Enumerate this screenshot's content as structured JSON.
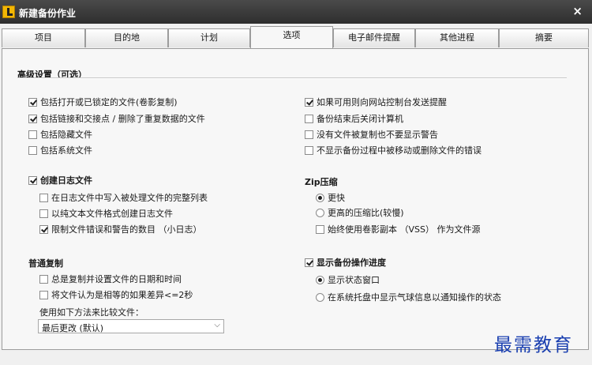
{
  "window": {
    "title": "新建备份作业",
    "close_glyph": "×"
  },
  "tabs": [
    {
      "label": "项目",
      "active": false
    },
    {
      "label": "目的地",
      "active": false
    },
    {
      "label": "计划",
      "active": false
    },
    {
      "label": "选项",
      "active": true
    },
    {
      "label": "电子邮件提醒",
      "active": false
    },
    {
      "label": "其他进程",
      "active": false
    },
    {
      "label": "摘要",
      "active": false
    }
  ],
  "advanced": {
    "title": "高级设置（可选）",
    "left": [
      {
        "label": "包括打开或已锁定的文件(卷影复制)",
        "checked": true
      },
      {
        "label": "包括链接和交接点 / 删除了重复数据的文件",
        "checked": true
      },
      {
        "label": "包括隐藏文件",
        "checked": false
      },
      {
        "label": "包括系统文件",
        "checked": false
      }
    ],
    "right": [
      {
        "label": "如果可用则向网站控制台发送提醒",
        "checked": true
      },
      {
        "label": "备份结束后关闭计算机",
        "checked": false
      },
      {
        "label": "没有文件被复制也不要显示警告",
        "checked": false
      },
      {
        "label": "不显示备份过程中被移动或删除文件的错误",
        "checked": false
      }
    ]
  },
  "log": {
    "label": "创建日志文件",
    "checked": true,
    "items": [
      {
        "label": "在日志文件中写入被处理文件的完整列表",
        "checked": false
      },
      {
        "label": "以纯文本文件格式创建日志文件",
        "checked": false
      },
      {
        "label": "限制文件错误和警告的数目 （小日志）",
        "checked": true
      }
    ]
  },
  "zip": {
    "title": "Zip压缩",
    "options": [
      {
        "label": "更快",
        "selected": true
      },
      {
        "label": "更高的压缩比(较慢)",
        "selected": false
      }
    ],
    "vss": {
      "label": "始终使用卷影副本 （VSS） 作为文件源",
      "checked": false
    }
  },
  "normal_copy": {
    "title": "普通复制",
    "items": [
      {
        "label": "总是复制并设置文件的日期和时间",
        "checked": false
      },
      {
        "label": "将文件认为是相等的如果差异<=2秒",
        "checked": false
      }
    ],
    "compare_label": "使用如下方法来比较文件：",
    "compare_value": "最后更改 (默认)"
  },
  "progress": {
    "label": "显示备份操作进度",
    "checked": true,
    "options": [
      {
        "label": "显示状态窗口",
        "selected": true
      },
      {
        "label": "在系统托盘中显示气球信息以通知操作的状态",
        "selected": false
      }
    ]
  },
  "watermark": "最需教育"
}
